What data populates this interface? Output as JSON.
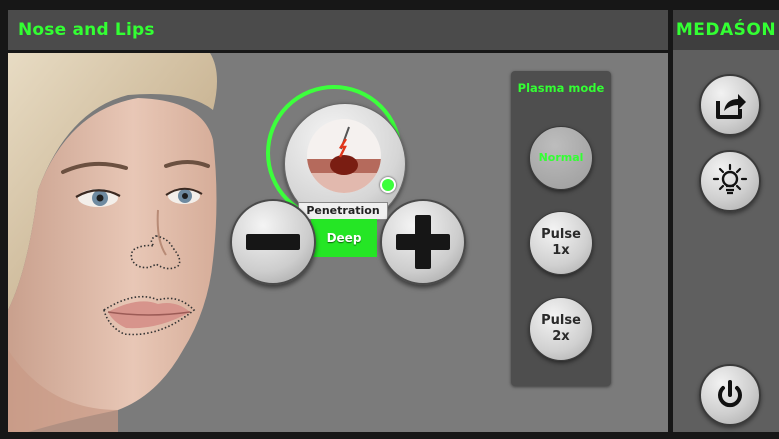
{
  "header": {
    "title": "Nose and Lips"
  },
  "brand": {
    "name": "MEDAŚON"
  },
  "depth": {
    "label": "Penetration",
    "value": "Deep",
    "decrease_icon": "minus-icon",
    "increase_icon": "plus-icon"
  },
  "plasma": {
    "title": "Plasma mode",
    "modes": [
      {
        "label": "Normal",
        "active": true
      },
      {
        "label": "Pulse\n1x",
        "active": false
      },
      {
        "label": "Pulse\n2x",
        "active": false
      }
    ]
  },
  "sidebar": {
    "buttons": [
      {
        "name": "export",
        "icon": "export-icon"
      },
      {
        "name": "light",
        "icon": "lightbulb-icon"
      },
      {
        "name": "power",
        "icon": "power-icon"
      }
    ]
  },
  "colors": {
    "accent": "#33ff33",
    "panel": "#4e4e4e",
    "background": "#7b7b7b"
  }
}
